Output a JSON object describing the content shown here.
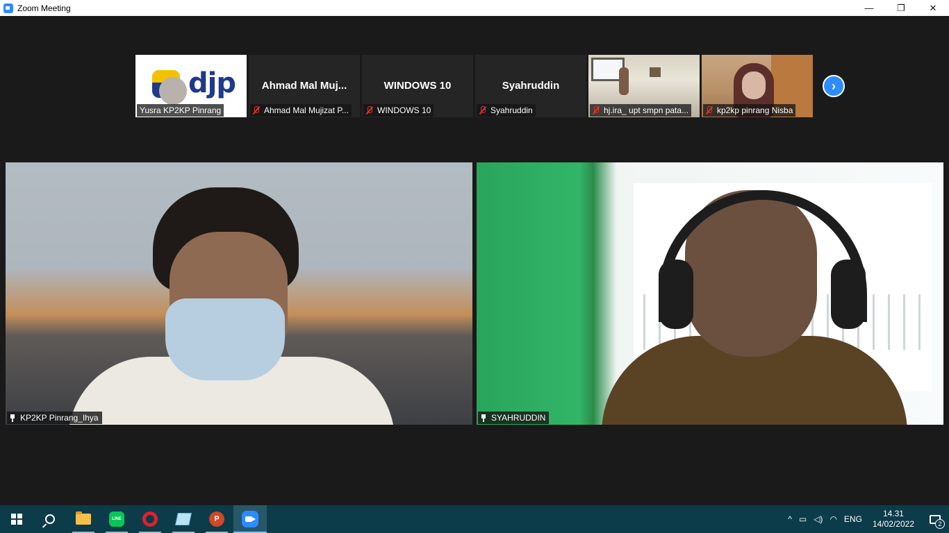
{
  "window": {
    "title": "Zoom Meeting",
    "controls": {
      "minimize": "—",
      "restore": "❐",
      "close": "✕"
    }
  },
  "colors": {
    "zoom_blue": "#2d8cff",
    "muted_red": "#e03131",
    "taskbar": "#0c3b4a",
    "background": "#1a1a1a"
  },
  "thumbnails": [
    {
      "big_name": "",
      "tag": "Yusra KP2KP Pinrang",
      "muted": false,
      "kind": "logo",
      "logo_text": "djp"
    },
    {
      "big_name": "Ahmad  Mal  Muj...",
      "tag": "Ahmad Mal Mujizat P...",
      "muted": true,
      "kind": "name"
    },
    {
      "big_name": "WINDOWS 10",
      "tag": "WINDOWS 10",
      "muted": true,
      "kind": "name"
    },
    {
      "big_name": "Syahruddin",
      "tag": "Syahruddin",
      "muted": true,
      "kind": "name"
    },
    {
      "big_name": "",
      "tag": "hj.ira_ upt smpn pata...",
      "muted": true,
      "kind": "photo"
    },
    {
      "big_name": "",
      "tag": "kp2kp pinrang Nisba",
      "muted": true,
      "kind": "photo"
    }
  ],
  "next_button_icon": "chevron-right-icon",
  "videos": [
    {
      "name": "KP2KP Pinrang_Ihya",
      "pinned": true
    },
    {
      "name": "SYAHRUDDIN",
      "pinned": true
    }
  ],
  "taskbar": {
    "apps": [
      {
        "name": "start",
        "icon": "windows-icon"
      },
      {
        "name": "search",
        "icon": "search-icon"
      },
      {
        "name": "file-explorer",
        "icon": "folder-icon",
        "running": true
      },
      {
        "name": "line",
        "icon": "line-icon",
        "label": "LINE",
        "running": true
      },
      {
        "name": "opera",
        "icon": "opera-icon",
        "running": true
      },
      {
        "name": "notes",
        "icon": "notes-icon",
        "running": true
      },
      {
        "name": "powerpoint",
        "icon": "powerpoint-icon",
        "label": "P",
        "running": true
      },
      {
        "name": "zoom",
        "icon": "zoom-icon",
        "active": true
      }
    ],
    "tray": {
      "chevron": "^",
      "language": "ENG",
      "time": "14.31",
      "date": "14/02/2022",
      "notifications": "2"
    }
  }
}
